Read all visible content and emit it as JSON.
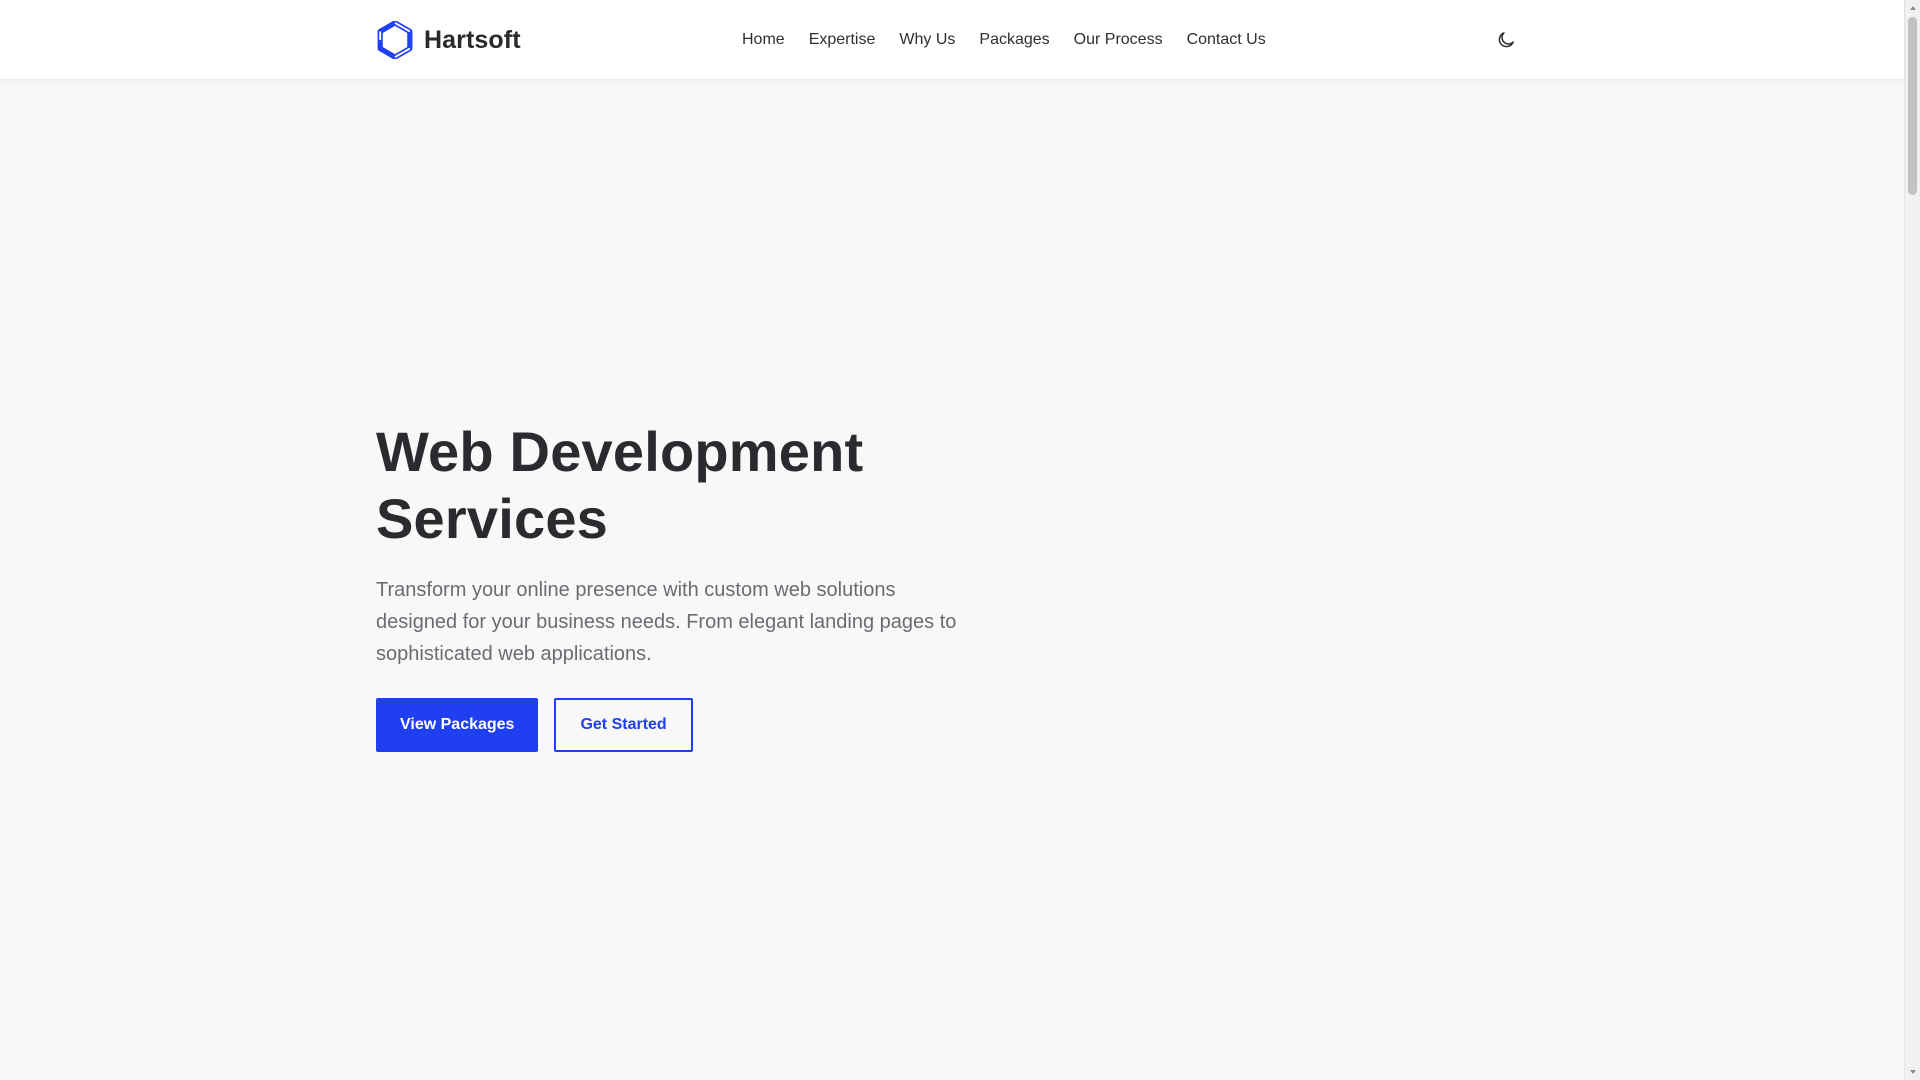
{
  "header": {
    "brand_name": "Hartsoft",
    "logo_icon": "hexagon-ring-logo",
    "nav": [
      {
        "label": "Home"
      },
      {
        "label": "Expertise"
      },
      {
        "label": "Why Us"
      },
      {
        "label": "Packages"
      },
      {
        "label": "Our Process"
      },
      {
        "label": "Contact Us"
      }
    ],
    "theme_toggle_icon": "moon-icon"
  },
  "hero": {
    "title_line1": "Web Development",
    "title_line2": "Services",
    "description": "Transform your online presence with custom web solutions designed for your business needs. From elegant landing pages to sophisticated web applications.",
    "primary_button": "View Packages",
    "secondary_button": "Get Started"
  },
  "colors": {
    "accent": "#1f3ff0",
    "background": "#f8f8f9",
    "header_bg": "#ffffff",
    "heading": "#2b2b2f",
    "body_text": "#6b6b72"
  }
}
